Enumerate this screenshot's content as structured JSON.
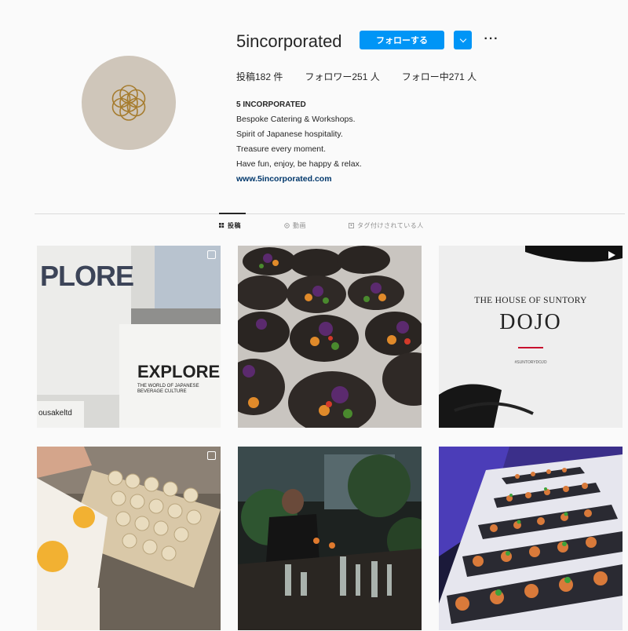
{
  "profile": {
    "username": "5incorporated",
    "follow_label": "フォローする",
    "stats": {
      "posts": "投稿182 件",
      "followers": "フォロワー251 人",
      "following": "フォロー中271 人"
    },
    "bio": {
      "name": "5 INCORPORATED",
      "lines": [
        "Bespoke Catering & Workshops.",
        "Spirit of Japanese hospitality.",
        "Treasure every moment.",
        "Have fun, enjoy, be happy & relax."
      ],
      "link": "www.5incorporated.com"
    }
  },
  "tabs": [
    {
      "label": "投稿",
      "icon": "grid-icon",
      "active": true
    },
    {
      "label": "動画",
      "icon": "video-icon",
      "active": false
    },
    {
      "label": "タグ付けされている人",
      "icon": "tag-icon",
      "active": false
    }
  ],
  "posts": [
    {
      "id": "post-1",
      "overlay_text_1": "PLORE",
      "overlay_text_2": "EXPLORE",
      "overlay_text_3": "THE WORLD OF JAPANESE BEVERAGE CULTURE",
      "caption": "ousakeltd",
      "badge": "multi-image-icon"
    },
    {
      "id": "post-2",
      "badge": ""
    },
    {
      "id": "post-3",
      "title_1": "THE HOUSE OF SUNTORY",
      "title_2": "DOJO",
      "hashtag": "#SUNTORYDOJO",
      "badge": "video-icon"
    },
    {
      "id": "post-4",
      "badge": "multi-image-icon"
    },
    {
      "id": "post-5",
      "badge": ""
    },
    {
      "id": "post-6",
      "badge": ""
    }
  ],
  "colors": {
    "accent": "#0095f6",
    "link": "#00376b",
    "avatar_bg": "#cfc6ba",
    "logo_gold": "#a67c2e"
  }
}
